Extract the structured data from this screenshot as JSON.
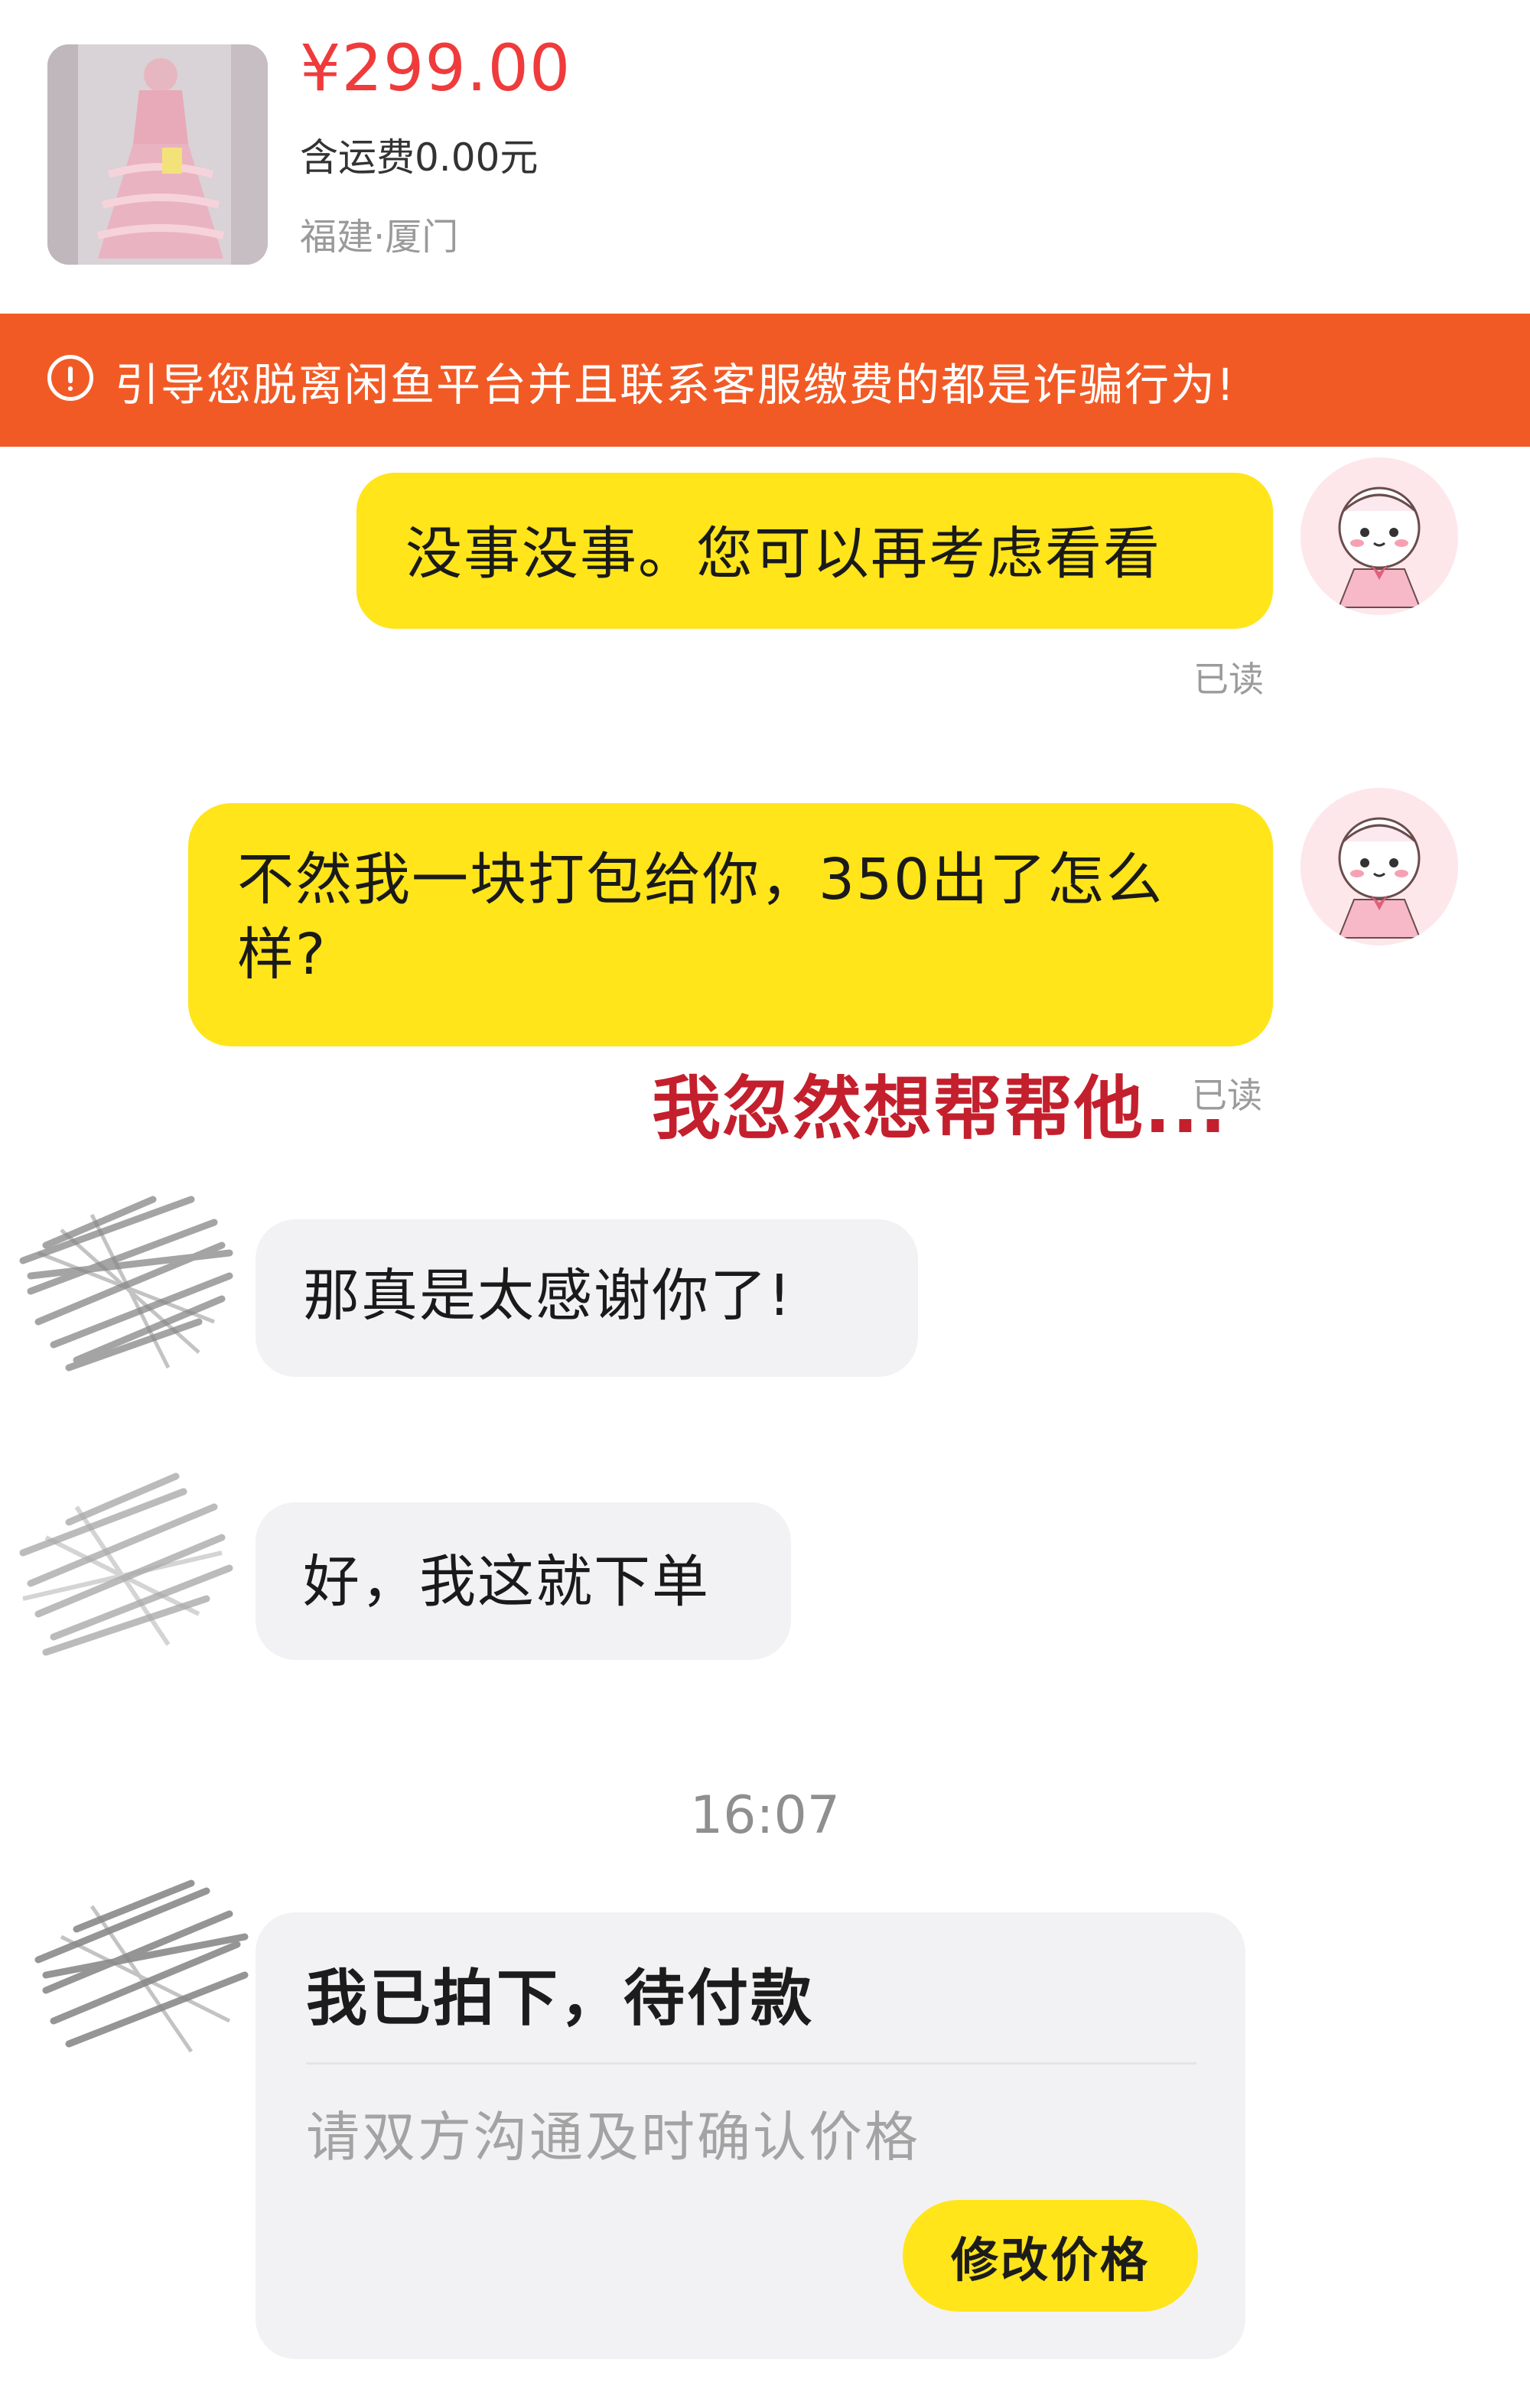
{
  "product": {
    "price": "¥299.00",
    "shipping": "含运费0.00元",
    "location": "福建·厦门"
  },
  "warning": {
    "icon": "alert-circle-icon",
    "text": "引导您脱离闲鱼平台并且联系客服缴费的都是诈骗行为!"
  },
  "messages": [
    {
      "side": "right",
      "text": "没事没事。您可以再考虑看看",
      "status": "已读"
    },
    {
      "side": "right",
      "text": "不然我一块打包给你，350出了怎么样?",
      "status": "已读"
    },
    {
      "side": "left",
      "text": "那真是太感谢你了!"
    },
    {
      "side": "left",
      "text": "好，我这就下单"
    }
  ],
  "annotation": "我忽然想帮帮他...",
  "timestamp": "16:07",
  "order_card": {
    "title": "我已拍下，待付款",
    "subtitle": "请双方沟通及时确认价格",
    "button": "修改价格"
  },
  "colors": {
    "price": "#ef3b3b",
    "banner": "#f25a25",
    "my_bubble": "#ffe51a",
    "their_bubble": "#f2f2f4",
    "annotation": "#c41f2d"
  }
}
